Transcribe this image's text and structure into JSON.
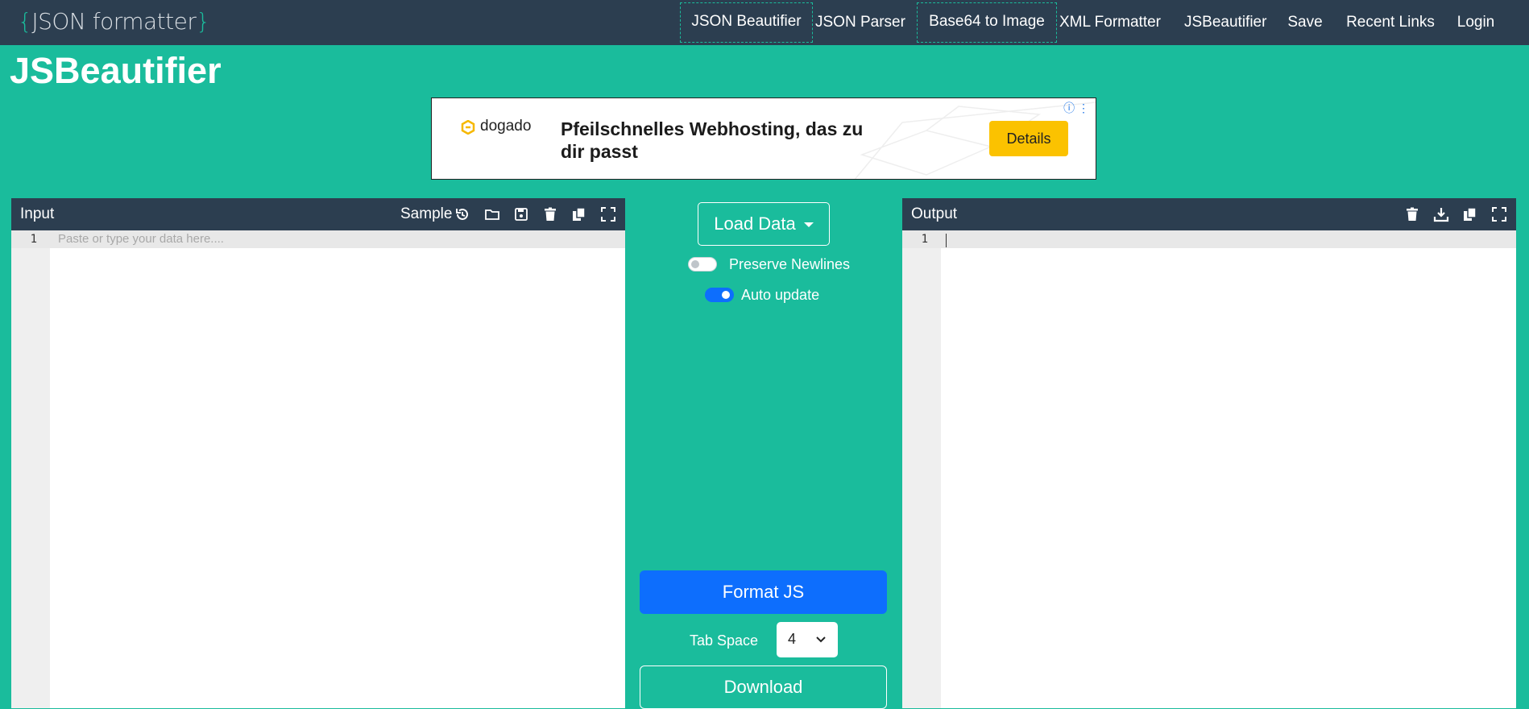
{
  "logo": {
    "open": "{",
    "text": "JSON formatter",
    "close": "}"
  },
  "nav": [
    {
      "label": "JSON Beautifier"
    },
    {
      "label": "JSON Parser"
    },
    {
      "label": "Base64 to Image"
    },
    {
      "label": "XML Formatter"
    },
    {
      "label": "JSBeautifier"
    },
    {
      "label": "Save"
    },
    {
      "label": "Recent Links"
    },
    {
      "label": "Login"
    }
  ],
  "page": {
    "title": "JSBeautifier"
  },
  "ad": {
    "brand": "dogado",
    "headline": "Pfeilschnelles Webhosting, das zu dir passt",
    "cta": "Details",
    "info": "ⓘ ⋮"
  },
  "input_panel": {
    "title": "Input",
    "sample_label": "Sample",
    "line_number": "1",
    "placeholder": "Paste or type your data here...."
  },
  "output_panel": {
    "title": "Output",
    "line_number": "1"
  },
  "controls": {
    "load_data": "Load Data",
    "preserve_newlines": {
      "label": "Preserve Newlines",
      "on": false
    },
    "auto_update": {
      "label": "Auto update",
      "on": true
    },
    "format_button": "Format JS",
    "tab_space_label": "Tab Space",
    "tab_space_value": "4",
    "download_button": "Download"
  },
  "colors": {
    "background": "#1abc9c",
    "navbar": "#2c3e50",
    "primary": "#0d6efd",
    "ad_button": "#fbc200"
  }
}
